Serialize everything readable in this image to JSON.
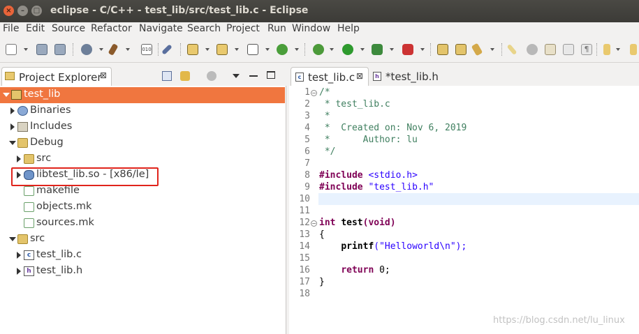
{
  "window": {
    "title": "eclipse - C/C++ - test_lib/src/test_lib.c - Eclipse"
  },
  "menu": [
    "File",
    "Edit",
    "Source",
    "Refactor",
    "Navigate",
    "Search",
    "Project",
    "Run",
    "Window",
    "Help"
  ],
  "project_explorer": {
    "tab_label": "Project Explorer",
    "close_glyph": "⊠",
    "tree": [
      {
        "label": "test_lib",
        "icon": "project-icon",
        "twisty": "down",
        "selected": true
      },
      {
        "label": "Binaries",
        "icon": "binaries-icon",
        "twisty": "right"
      },
      {
        "label": "Includes",
        "icon": "includes-icon",
        "twisty": "right"
      },
      {
        "label": "Debug",
        "icon": "folder-icon",
        "twisty": "down"
      },
      {
        "label": "src",
        "icon": "folder-icon",
        "twisty": "right"
      },
      {
        "label": "libtest_lib.so - [x86/le]",
        "icon": "shared-library-icon",
        "twisty": "right"
      },
      {
        "label": "makefile",
        "icon": "makefile-icon"
      },
      {
        "label": "objects.mk",
        "icon": "makefile-icon"
      },
      {
        "label": "sources.mk",
        "icon": "makefile-icon"
      },
      {
        "label": "src",
        "icon": "folder-icon",
        "twisty": "down"
      },
      {
        "label": "test_lib.c",
        "icon": "c-file-icon",
        "twisty": "right"
      },
      {
        "label": "test_lib.h",
        "icon": "h-file-icon",
        "twisty": "right"
      }
    ]
  },
  "editor": {
    "tabs": [
      {
        "label": "test_lib.c",
        "icon_text": "c",
        "active": true
      },
      {
        "label": "*test_lib.h",
        "icon_text": "h",
        "active": false
      }
    ],
    "line_numbers": [
      "1",
      "2",
      "3",
      "4",
      "5",
      "6",
      "7",
      "8",
      "9",
      "10",
      "11",
      "12",
      "13",
      "14",
      "15",
      "16",
      "17",
      "18"
    ],
    "lines": [
      "/*",
      " * test_lib.c",
      " *",
      " *  Created on: Nov 6, 2019",
      " *      Author: lu",
      " */",
      "",
      "#include <stdio.h>",
      "#include \"test_lib.h\"",
      "",
      "",
      "int test(void)",
      "{",
      "    printf(\"Helloworld\\n\");",
      "",
      "    return 0;",
      "}",
      ""
    ],
    "tokens": {
      "include_kw": "#include",
      "stdio": "<stdio.h>",
      "header": "\"test_lib.h\"",
      "int_kw": "int",
      "fn_name": "test",
      "void_kw": "(void)",
      "printf": "printf",
      "printf_arg": "(\"Helloworld\\n\");",
      "return_kw": "return",
      "return_val": " 0;"
    }
  },
  "watermark": "https://blog.csdn.net/lu_linux",
  "colors": {
    "selection": "#f0763f",
    "highlight_box": "#e0241c",
    "keyword": "#7f0055",
    "comment": "#3f7f5f",
    "string": "#2a00ff"
  }
}
